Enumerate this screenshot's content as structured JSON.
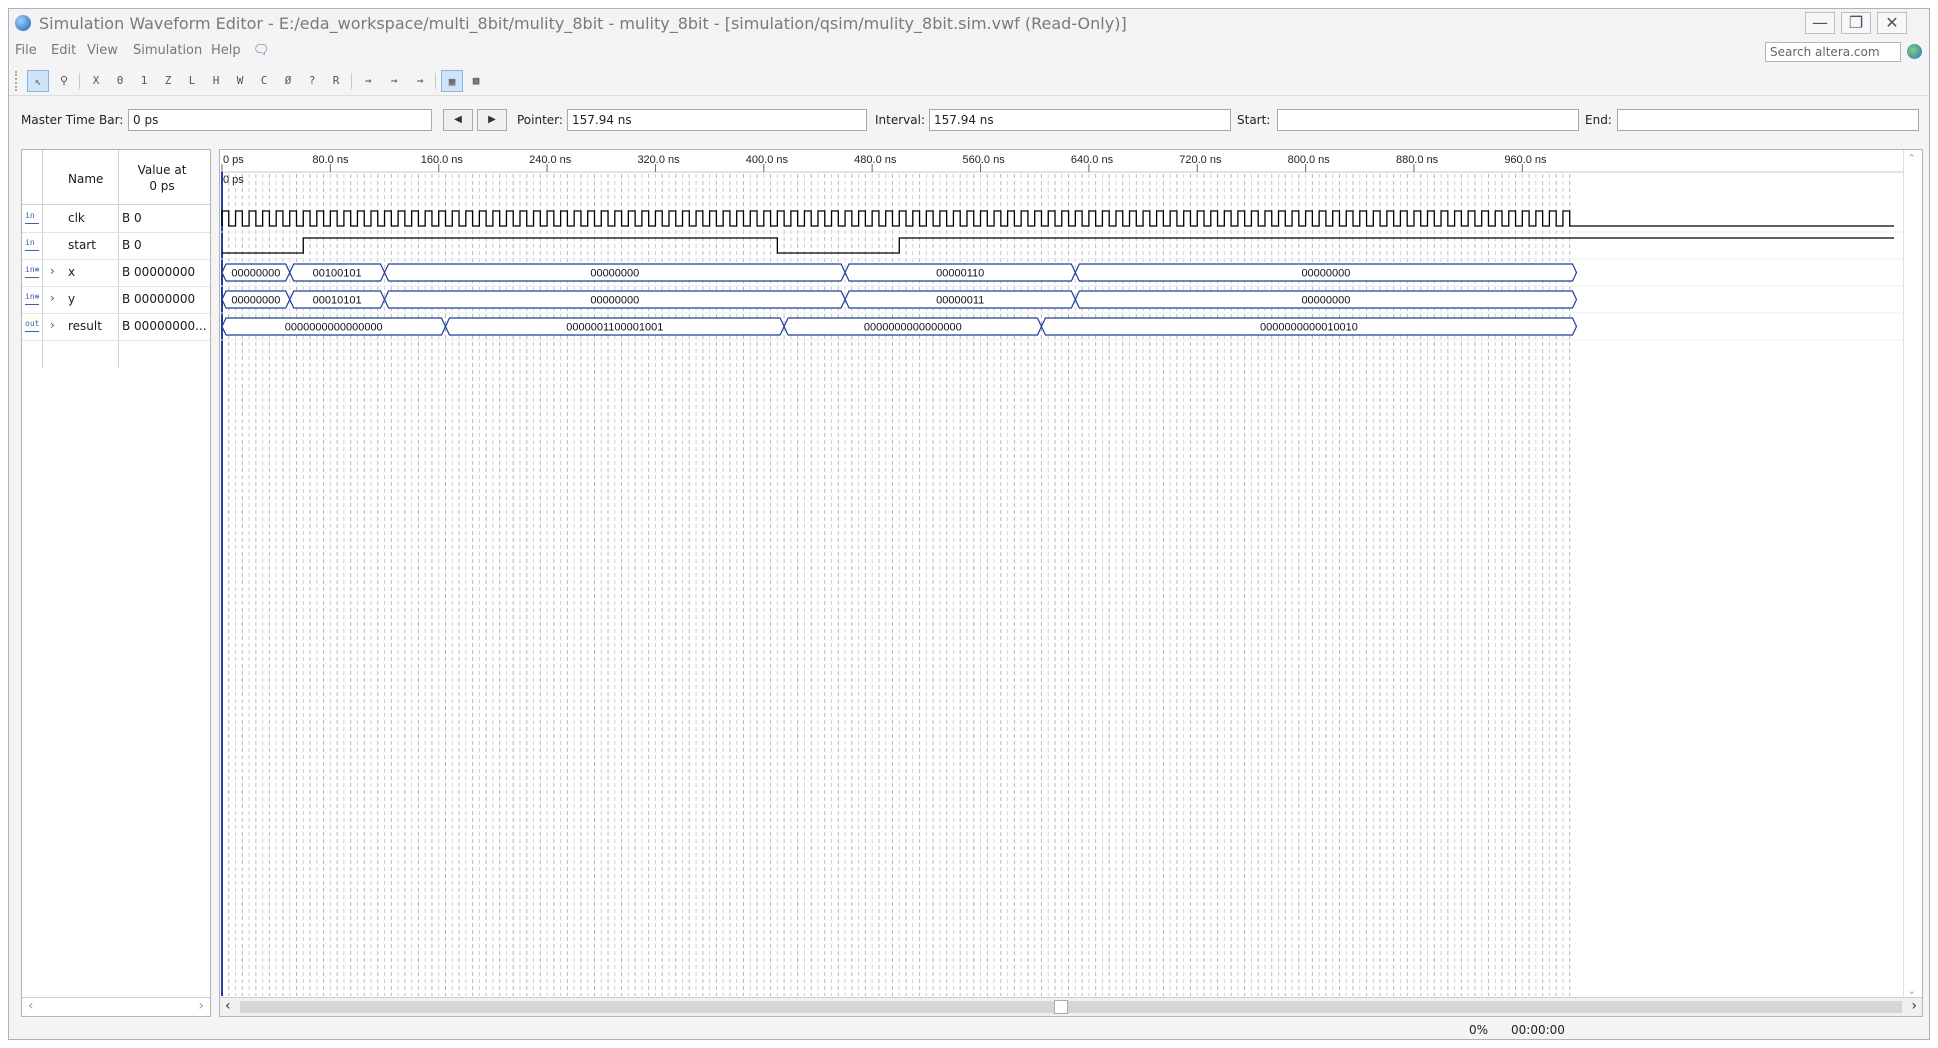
{
  "window": {
    "title": "Simulation Waveform Editor - E:/eda_workspace/multi_8bit/mulity_8bit - mulity_8bit - [simulation/qsim/mulity_8bit.sim.vwf (Read-Only)]",
    "controls": [
      "minimize",
      "restore",
      "close"
    ]
  },
  "menu": {
    "items": [
      "File",
      "Edit",
      "View",
      "Simulation",
      "Help"
    ],
    "search_placeholder": "Search altera.com"
  },
  "toolbar": {
    "buttons": [
      "selection-tool",
      "zoom-tool",
      "force-unknown",
      "force-low",
      "force-high",
      "force-high-impedance",
      "force-weak-low",
      "force-weak-high",
      "invert",
      "count-value",
      "overwrite-clock",
      "random-values",
      "snap-to-grid",
      "waveform-settings",
      "find",
      "replace",
      "grid",
      "run-functional",
      "run-timing",
      "run-timing-netlist",
      "generate-netlist",
      "simulation-settings"
    ]
  },
  "timebar": {
    "master_label": "Master Time Bar:",
    "master_value": "0 ps",
    "pointer_label": "Pointer:",
    "pointer_value": "157.94 ns",
    "interval_label": "Interval:",
    "interval_value": "157.94 ns",
    "start_label": "Start:",
    "start_value": "",
    "end_label": "End:",
    "end_value": ""
  },
  "signals": {
    "header_name": "Name",
    "header_value_line1": "Value at",
    "header_value_line2": "0 ps",
    "rows": [
      {
        "name": "clk",
        "value": "B 0",
        "dir": "in",
        "expandable": false
      },
      {
        "name": "start",
        "value": "B 0",
        "dir": "in",
        "expandable": false
      },
      {
        "name": "x",
        "value": "B 00000000",
        "dir": "in-bus",
        "expandable": true
      },
      {
        "name": "y",
        "value": "B 00000000",
        "dir": "in-bus",
        "expandable": true
      },
      {
        "name": "result",
        "value": "B 00000000...",
        "dir": "out-bus",
        "expandable": true
      }
    ]
  },
  "waveform": {
    "time_range_ns": [
      0,
      1000
    ],
    "cursor_label": "0 ps",
    "axis_labels": [
      {
        "t": 0,
        "label": "0 ps"
      },
      {
        "t": 80,
        "label": "80.0 ns"
      },
      {
        "t": 160,
        "label": "160.0 ns"
      },
      {
        "t": 240,
        "label": "240.0 ns"
      },
      {
        "t": 320,
        "label": "320.0 ns"
      },
      {
        "t": 400,
        "label": "400.0 ns"
      },
      {
        "t": 480,
        "label": "480.0 ns"
      },
      {
        "t": 560,
        "label": "560.0 ns"
      },
      {
        "t": 640,
        "label": "640.0 ns"
      },
      {
        "t": 720,
        "label": "720.0 ns"
      },
      {
        "t": 800,
        "label": "800.0 ns"
      },
      {
        "t": 880,
        "label": "880.0 ns"
      },
      {
        "t": 960,
        "label": "960.0 ns"
      }
    ],
    "clk_period_ns": 10,
    "start_transitions": [
      {
        "t": 0,
        "v": 0
      },
      {
        "t": 60,
        "v": 1
      },
      {
        "t": 410,
        "v": 0
      },
      {
        "t": 500,
        "v": 1
      }
    ],
    "buses": [
      {
        "name": "x",
        "segments": [
          {
            "t0": 0,
            "t1": 50,
            "value": "00000000"
          },
          {
            "t0": 50,
            "t1": 120,
            "value": "00100101"
          },
          {
            "t0": 120,
            "t1": 460,
            "value": "00000000"
          },
          {
            "t0": 460,
            "t1": 630,
            "value": "00000110"
          },
          {
            "t0": 630,
            "t1": 1000,
            "value": "00000000"
          }
        ]
      },
      {
        "name": "y",
        "segments": [
          {
            "t0": 0,
            "t1": 50,
            "value": "00000000"
          },
          {
            "t0": 50,
            "t1": 120,
            "value": "00010101"
          },
          {
            "t0": 120,
            "t1": 460,
            "value": "00000000"
          },
          {
            "t0": 460,
            "t1": 630,
            "value": "00000011"
          },
          {
            "t0": 630,
            "t1": 1000,
            "value": "00000000"
          }
        ]
      },
      {
        "name": "result",
        "segments": [
          {
            "t0": 0,
            "t1": 165,
            "value": "0000000000000000"
          },
          {
            "t0": 165,
            "t1": 415,
            "value": "0000001100001001"
          },
          {
            "t0": 415,
            "t1": 605,
            "value": "0000000000000000"
          },
          {
            "t0": 605,
            "t1": 1000,
            "value": "0000000000010010"
          }
        ]
      }
    ]
  },
  "status": {
    "progress": "0%",
    "elapsed": "00:00:00"
  }
}
